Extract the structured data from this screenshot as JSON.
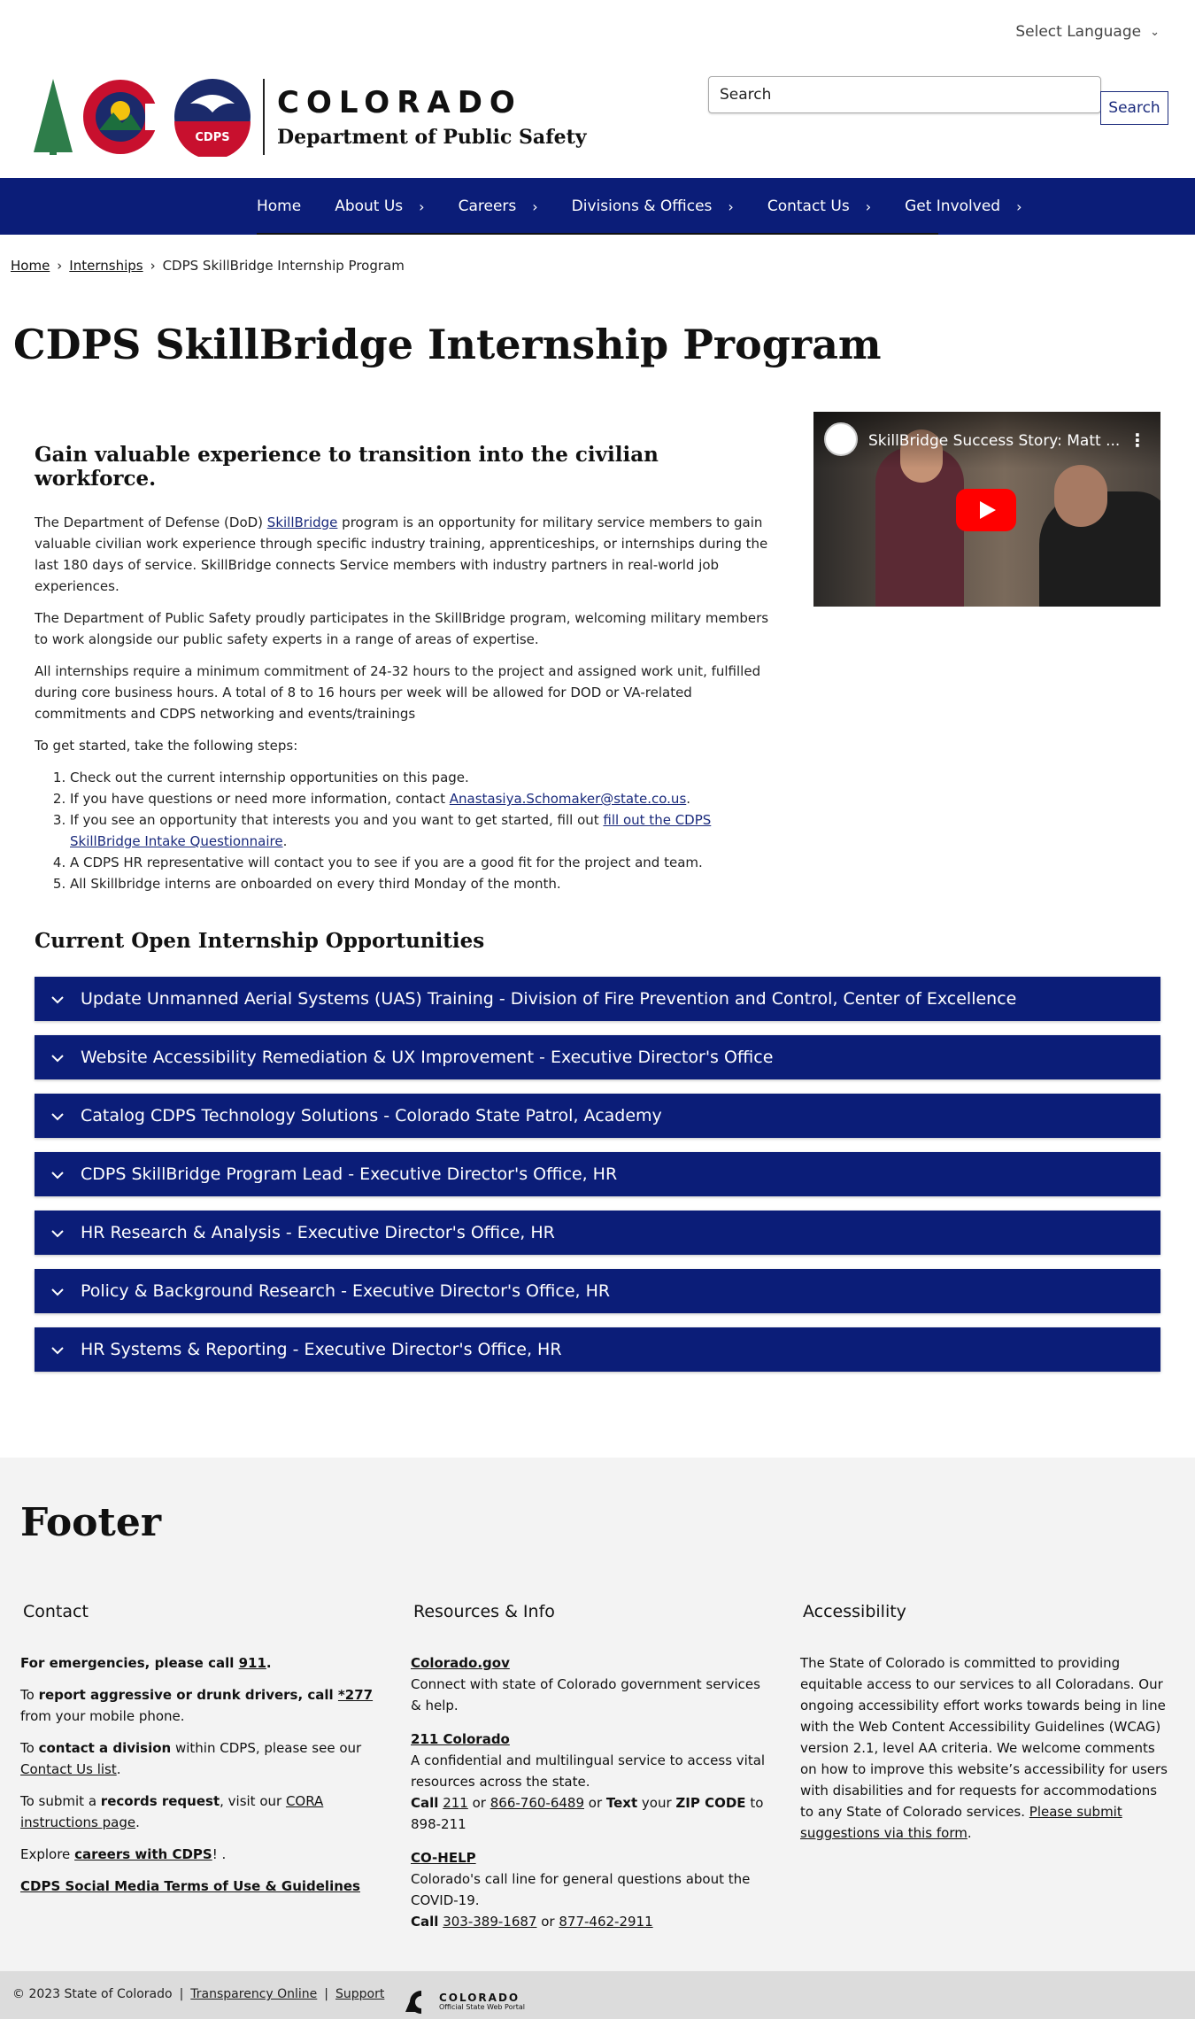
{
  "language": {
    "label": "Select Language"
  },
  "header": {
    "logo_colorado": "COLORADO",
    "logo_department": "Department of Public Safety",
    "logo_cdps_badge": "CDPS",
    "search_placeholder": "Search",
    "search_button": "Search"
  },
  "nav": {
    "items": [
      {
        "label": "Home",
        "has_submenu": false
      },
      {
        "label": "About Us",
        "has_submenu": true
      },
      {
        "label": "Careers",
        "has_submenu": true
      },
      {
        "label": "Divisions & Offices",
        "has_submenu": true
      },
      {
        "label": "Contact Us",
        "has_submenu": true
      },
      {
        "label": "Get Involved",
        "has_submenu": true
      }
    ]
  },
  "breadcrumb": {
    "items": [
      "Home",
      "Internships",
      "CDPS SkillBridge Internship Program"
    ],
    "separator": "›"
  },
  "page_title": "CDPS SkillBridge Internship Program",
  "main": {
    "heading": "Gain valuable experience to transition into the civilian workforce.",
    "p1_before": "The Department of Defense (DoD) ",
    "p1_link": "SkillBridge",
    "p1_after": " program is an opportunity for military service members to gain valuable civilian work experience through specific industry training, apprenticeships, or internships during the last 180 days of service. SkillBridge connects Service members with industry partners in real-world job experiences.",
    "p2": "The Department of Public Safety proudly participates in the SkillBridge program, welcoming military members to work alongside our public safety experts in a range of areas of expertise.",
    "p3": "All internships require a minimum commitment of 24-32 hours to the project and assigned work unit, fulfilled during core business hours.  A total of 8 to 16 hours per week will be allowed for DOD or VA-related commitments and CDPS networking and events/trainings",
    "p4": "To get started, take the following steps:",
    "steps": {
      "s1": "Check out the current internship opportunities on this page.",
      "s2_before": "If you have questions or need more information, contact ",
      "s2_link": "Anastasiya.Schomaker@state.co.us",
      "s2_after": ".",
      "s3_before": "If you see an opportunity that interests you and you want to get started, fill out ",
      "s3_link": "fill out the CDPS SkillBridge Intake Questionnaire",
      "s3_after": ".",
      "s4": "A CDPS HR representative will contact you to see if you are a good fit for the project and team.",
      "s5": "All Skillbridge interns are onboarded on every third Monday of the month."
    }
  },
  "video": {
    "title": "SkillBridge Success Story: Matt ..."
  },
  "opportunities": {
    "heading": "Current Open Internship Opportunities",
    "items": [
      "Update Unmanned Aerial Systems (UAS) Training - Division of Fire Prevention and Control, Center of Excellence",
      "Website Accessibility Remediation & UX Improvement - Executive Director's Office",
      "Catalog CDPS Technology Solutions - Colorado State Patrol, Academy",
      "CDPS SkillBridge Program Lead - Executive Director's Office, HR",
      "HR Research & Analysis - Executive Director's Office, HR",
      "Policy & Background Research - Executive Director's Office, HR",
      "HR Systems & Reporting - Executive Director's Office, HR"
    ]
  },
  "footer": {
    "heading": "Footer",
    "contact": {
      "heading": "Contact",
      "emergency_text": "For emergencies, please call ",
      "emergency_link": "911",
      "emergency_end": ".",
      "report_pre": "To ",
      "report_bold": "report aggressive or drunk drivers, call ",
      "report_link": "*277",
      "report_post": " from your mobile phone.",
      "division_pre": "To ",
      "division_bold": "contact a division",
      "division_mid": " within CDPS, please see our ",
      "division_link": "Contact Us list",
      "division_end": ".",
      "records_pre": "To submit a ",
      "records_bold": "records request",
      "records_mid": ", visit our ",
      "records_link": "CORA instructions page",
      "records_end": ".",
      "careers_pre": "Explore ",
      "careers_link": "careers with CDPS",
      "careers_end": "! .",
      "social_link": "CDPS Social Media Terms of Use & Guidelines"
    },
    "resources": {
      "heading": "Resources & Info",
      "r1_title": "Colorado.gov",
      "r1_desc": "Connect with state of Colorado government services & help.",
      "r2_title": "211 Colorado",
      "r2_desc": "A confidential and multilingual service to access vital resources across the state.",
      "r2_call": "Call",
      "r2_n1": "211",
      "r2_or": " or ",
      "r2_n2": "866-760-6489",
      "r2_or2": " or ",
      "r2_text": "Text",
      "r2_your": " your ",
      "r2_zip": "ZIP CODE",
      "r2_to": " to 898-211",
      "r3_title": "CO-HELP",
      "r3_desc": "Colorado's call line for general questions about the COVID-19.",
      "r3_call": "Call",
      "r3_n1": "303-389-1687",
      "r3_or": " or ",
      "r3_n2": "877-462-2911"
    },
    "accessibility": {
      "heading": "Accessibility",
      "text": "The State of Colorado is committed to providing equitable access to our services to all Coloradans. Our ongoing accessibility effort works towards being in line with the Web Content Accessibility Guidelines (WCAG) version 2.1, level AA criteria. We welcome comments on how to improve this website’s accessibility for users with disabilities and for requests for accommodations to any State of Colorado services. ",
      "link": "Please submit suggestions via this form",
      "end": "."
    }
  },
  "bottom_bar": {
    "copyright": "© 2023 State of Colorado",
    "sep": "|",
    "link1": "Transparency Online",
    "link2": "Support",
    "portal_name": "COLORADO",
    "portal_sub": "Official State Web Portal"
  }
}
